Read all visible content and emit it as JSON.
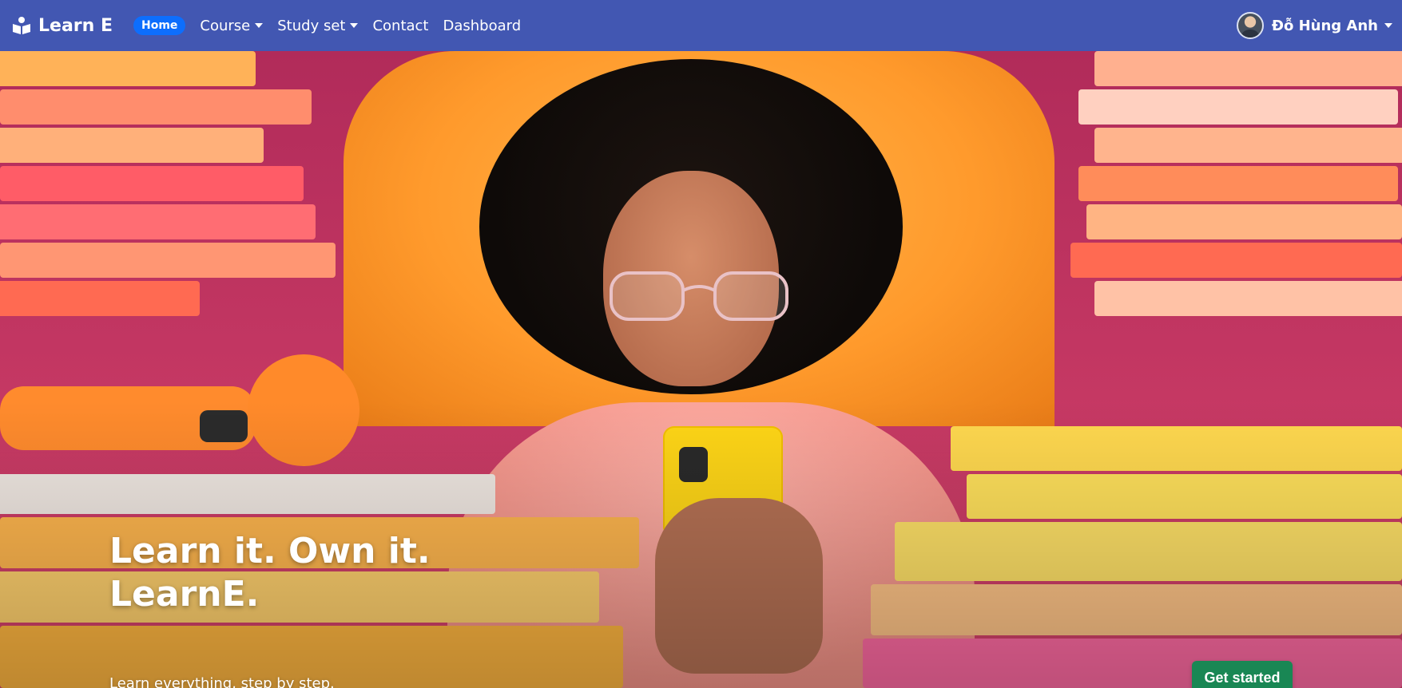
{
  "navbar": {
    "brand": "Learn E",
    "home_label": "Home",
    "items": [
      {
        "label": "Course",
        "dropdown": true
      },
      {
        "label": "Study set",
        "dropdown": true
      },
      {
        "label": "Contact",
        "dropdown": false
      },
      {
        "label": "Dashboard",
        "dropdown": false
      }
    ],
    "user_name": "Đỗ Hùng Anh"
  },
  "hero": {
    "headline_line1": "Learn it. Own it.",
    "headline_line2": "LearnE.",
    "tagline": "Learn everything, step by step.",
    "cta_label": "Get started"
  },
  "colors": {
    "navbar_bg": "#4257b2",
    "home_pill": "#0d6efd",
    "cta_bg": "#198754"
  },
  "icons": {
    "brand": "book-reader-icon",
    "dropdown": "caret-down-icon"
  }
}
